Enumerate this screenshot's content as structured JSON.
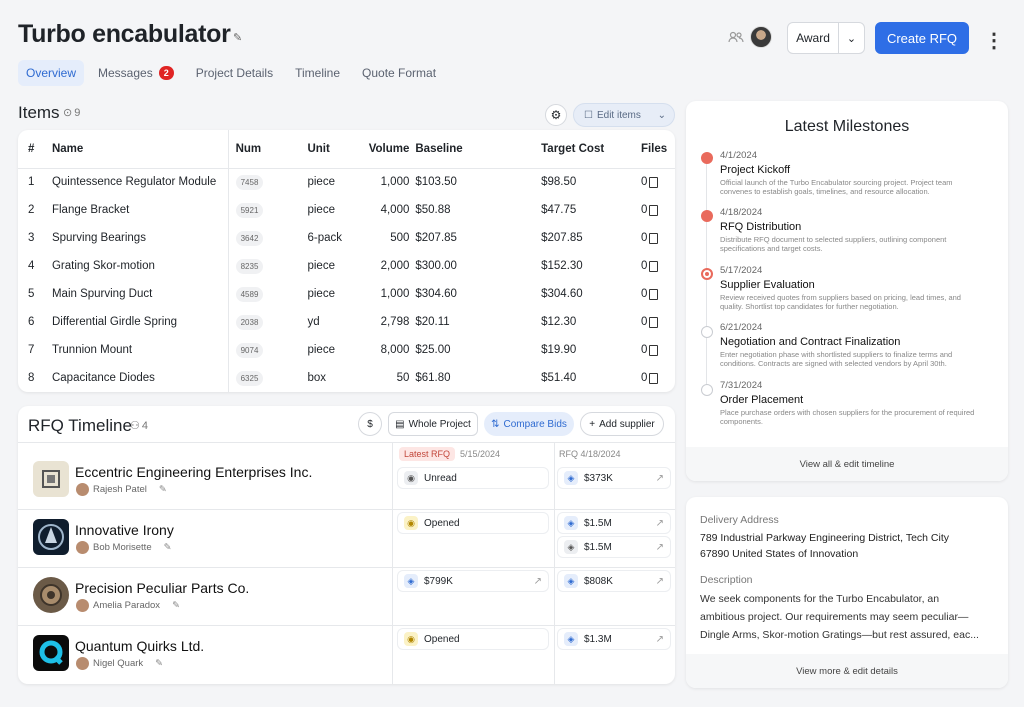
{
  "page": {
    "title": "Turbo encabulator"
  },
  "tabs": [
    {
      "label": "Overview"
    },
    {
      "label": "Messages",
      "badge": "2"
    },
    {
      "label": "Project Details"
    },
    {
      "label": "Timeline"
    },
    {
      "label": "Quote Format"
    }
  ],
  "header": {
    "award_label": "Award",
    "create_label": "Create RFQ"
  },
  "items": {
    "title": "Items",
    "count": "9",
    "edit_label": "Edit items",
    "columns": [
      "#",
      "Name",
      "Num",
      "Unit",
      "Volume",
      "Baseline",
      "Target Cost",
      "Files"
    ],
    "rows": [
      {
        "n": "1",
        "name": "Quintessence Regulator Module",
        "num": "7458",
        "unit": "piece",
        "volume": "1,000",
        "baseline": "$103.50",
        "target": "$98.50",
        "files": "0"
      },
      {
        "n": "2",
        "name": "Flange Bracket",
        "num": "5921",
        "unit": "piece",
        "volume": "4,000",
        "baseline": "$50.88",
        "target": "$47.75",
        "files": "0"
      },
      {
        "n": "3",
        "name": "Spurving Bearings",
        "num": "3642",
        "unit": "6-pack",
        "volume": "500",
        "baseline": "$207.85",
        "target": "$207.85",
        "files": "0"
      },
      {
        "n": "4",
        "name": "Grating Skor-motion",
        "num": "8235",
        "unit": "piece",
        "volume": "2,000",
        "baseline": "$300.00",
        "target": "$152.30",
        "files": "0"
      },
      {
        "n": "5",
        "name": "Main Spurving Duct",
        "num": "4589",
        "unit": "piece",
        "volume": "1,000",
        "baseline": "$304.60",
        "target": "$304.60",
        "files": "0"
      },
      {
        "n": "6",
        "name": "Differential Girdle Spring",
        "num": "2038",
        "unit": "yd",
        "volume": "2,798",
        "baseline": "$20.11",
        "target": "$12.30",
        "files": "0"
      },
      {
        "n": "7",
        "name": "Trunnion Mount",
        "num": "9074",
        "unit": "piece",
        "volume": "8,000",
        "baseline": "$25.00",
        "target": "$19.90",
        "files": "0"
      },
      {
        "n": "8",
        "name": "Capacitance Diodes",
        "num": "6325",
        "unit": "box",
        "volume": "50",
        "baseline": "$61.80",
        "target": "$51.40",
        "files": "0"
      }
    ]
  },
  "rfq": {
    "title": "RFQ Timeline",
    "count": "4",
    "dollar": "$",
    "whole_project": "Whole Project",
    "compare_bids": "Compare Bids",
    "add_supplier": "Add supplier",
    "col1_badge": "Latest RFQ",
    "col1_date": "5/15/2024",
    "col2_label": "RFQ 4/18/2024",
    "suppliers": [
      {
        "name": "Eccentric Engineering Enterprises Inc.",
        "contact": "Rajesh Patel"
      },
      {
        "name": "Innovative Irony",
        "contact": "Bob Morisette"
      },
      {
        "name": "Precision Peculiar Parts Co.",
        "contact": "Amelia Paradox"
      },
      {
        "name": "Quantum Quirks Ltd.",
        "contact": "Nigel Quark"
      }
    ],
    "cells": {
      "s1c1": "Unread",
      "s1c2": "$373K",
      "s2c1": "Opened",
      "s2c2a": "$1.5M",
      "s2c2b": "$1.5M",
      "s3c1": "$799K",
      "s3c2": "$808K",
      "s4c1": "Opened",
      "s4c2": "$1.3M"
    }
  },
  "milestones": {
    "title": "Latest Milestones",
    "footer": "View all & edit timeline",
    "items": [
      {
        "date": "4/1/2024",
        "title": "Project Kickoff",
        "desc": "Official launch of the Turbo Encabulator sourcing project. Project team convenes to establish goals, timelines, and resource allocation."
      },
      {
        "date": "4/18/2024",
        "title": "RFQ Distribution",
        "desc": "Distribute RFQ document to selected suppliers, outlining component specifications and target costs."
      },
      {
        "date": "5/17/2024",
        "title": "Supplier Evaluation",
        "desc": "Review received quotes from suppliers based on pricing, lead times, and quality. Shortlist top candidates for further negotiation."
      },
      {
        "date": "6/21/2024",
        "title": "Negotiation and Contract Finalization",
        "desc": "Enter negotiation phase with shortlisted suppliers to finalize terms and conditions. Contracts are signed with selected vendors by April 30th."
      },
      {
        "date": "7/31/2024",
        "title": "Order Placement",
        "desc": "Place purchase orders with chosen suppliers for the procurement of required components."
      }
    ]
  },
  "details": {
    "delivery_label": "Delivery Address",
    "address1": "789 Industrial Parkway Engineering District, Tech City",
    "address2": "67890 United States of Innovation",
    "description_label": "Description",
    "desc1": "We seek components for the Turbo Encabulator, an",
    "desc2": "ambitious project. Our requirements may seem peculiar—",
    "desc3": "Dingle Arms, Skor-motion Gratings—but rest assured, eac...",
    "footer": "View more & edit details"
  }
}
